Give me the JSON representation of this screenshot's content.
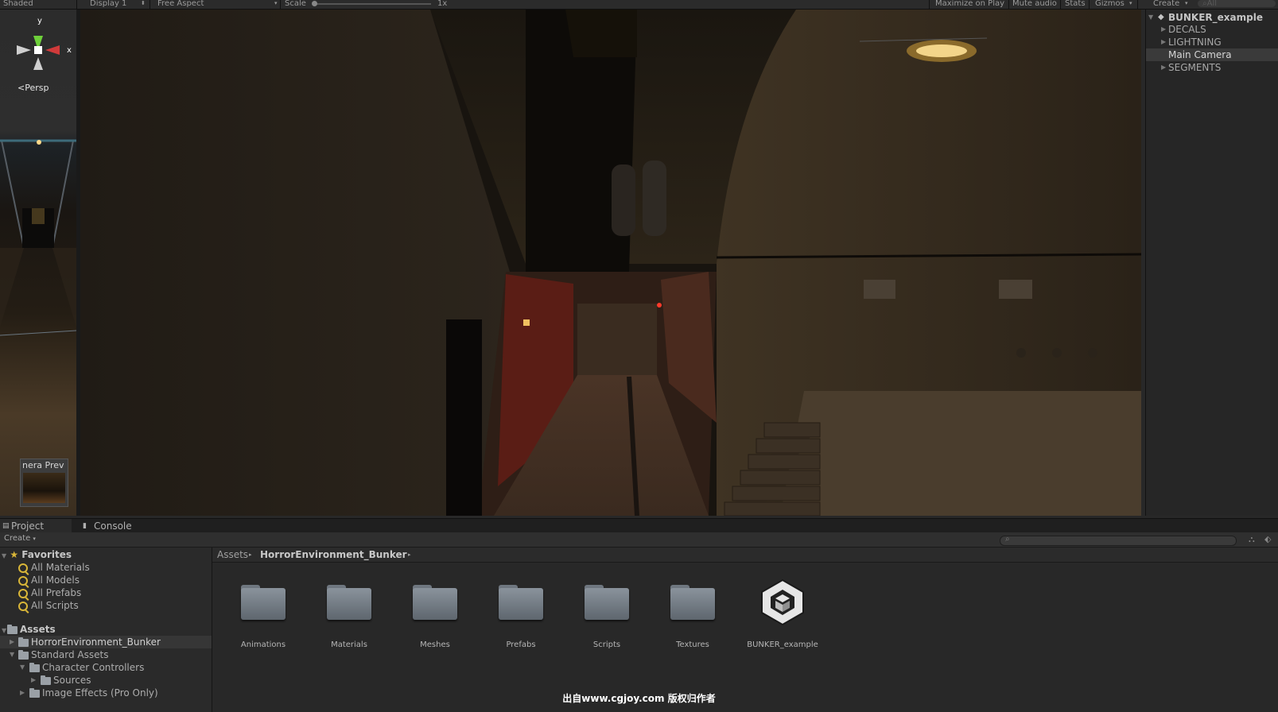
{
  "toolbar": {
    "shading_mode": "Shaded",
    "display": "Display 1",
    "aspect": "Free Aspect",
    "scale_label": "Scale",
    "scale_value": "1x",
    "maximize_on_play": "Maximize on Play",
    "mute_audio": "Mute audio",
    "stats": "Stats",
    "gizmos": "Gizmos",
    "create": "Create",
    "search_all": "All"
  },
  "scene": {
    "axis_y": "y",
    "axis_x": "x",
    "projection": "Persp",
    "camera_preview_label": "nera Prev"
  },
  "hierarchy": {
    "scene_name": "BUNKER_example",
    "items": [
      {
        "label": "DECALS",
        "selected": false
      },
      {
        "label": "LIGHTNING",
        "selected": false
      },
      {
        "label": "Main Camera",
        "selected": true
      },
      {
        "label": "SEGMENTS",
        "selected": false
      }
    ]
  },
  "tabs": {
    "project": "Project",
    "console": "Console"
  },
  "project_toolbar": {
    "create": "Create"
  },
  "favorites": {
    "title": "Favorites",
    "items": [
      "All Materials",
      "All Models",
      "All Prefabs",
      "All Scripts"
    ]
  },
  "assets_tree": {
    "title": "Assets",
    "items": [
      {
        "label": "HorrorEnvironment_Bunker",
        "depth": 1,
        "selected": true
      },
      {
        "label": "Standard Assets",
        "depth": 1,
        "selected": false
      },
      {
        "label": "Character Controllers",
        "depth": 2,
        "selected": false
      },
      {
        "label": "Sources",
        "depth": 3,
        "selected": false
      },
      {
        "label": "Image Effects (Pro Only)",
        "depth": 2,
        "selected": false
      }
    ]
  },
  "breadcrumb": {
    "root": "Assets",
    "current": "HorrorEnvironment_Bunker"
  },
  "assets": [
    {
      "label": "Animations",
      "type": "folder"
    },
    {
      "label": "Materials",
      "type": "folder"
    },
    {
      "label": "Meshes",
      "type": "folder"
    },
    {
      "label": "Prefabs",
      "type": "folder"
    },
    {
      "label": "Scripts",
      "type": "folder"
    },
    {
      "label": "Textures",
      "type": "folder"
    },
    {
      "label": "BUNKER_example",
      "type": "scene"
    }
  ],
  "watermark": "出自www.cgjoy.com 版权归作者",
  "colors": {
    "panel_bg": "#282828",
    "selection": "#3a3a3a",
    "favorite_accent": "#d9b638"
  }
}
